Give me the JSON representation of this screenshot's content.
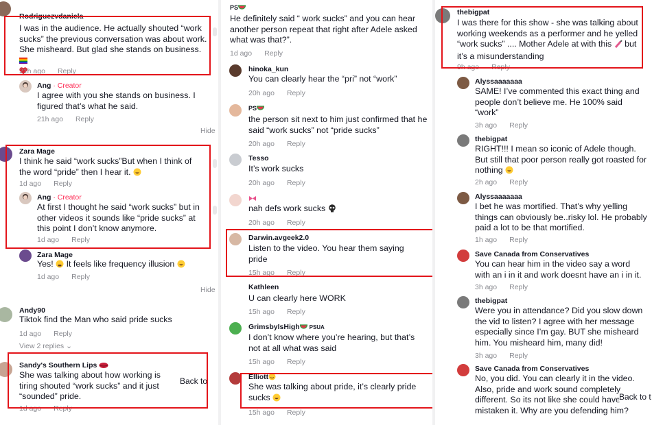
{
  "col1": {
    "c1": {
      "username": "Rodriguezvdaniela",
      "text": "I was in the audience. He actually shouted “work sucks” the previous conversation was about work. She misheard. But glad she stands on business.",
      "time": "21h ago",
      "reply": "Reply"
    },
    "c1r": {
      "username": "Ang",
      "badge": "· Creator",
      "text": "I agree with you she stands on business. I figured that’s what he said.",
      "time": "21h ago",
      "reply": "Reply"
    },
    "hide1": "Hide",
    "c2": {
      "username": "Zara Mage",
      "text": "I think he said “work sucks”But when I think of the word “pride” then I hear it.",
      "time": "1d ago",
      "reply": "Reply"
    },
    "c2r": {
      "username": "Ang",
      "badge": "· Creator",
      "text": "At first I thought he said “work sucks” but in other videos it sounds like “pride sucks” at this point I don’t know anymore.",
      "time": "1d ago",
      "reply": "Reply"
    },
    "c2r2": {
      "username": "Zara Mage",
      "text_a": "Yes!",
      "text_b": "It feels like frequency illusion",
      "time": "1d ago",
      "reply": "Reply"
    },
    "hide2": "Hide",
    "c3": {
      "username": "Andy90",
      "text": "Tiktok find the Man who said pride sucks",
      "time": "1d ago",
      "reply": "Reply",
      "view_replies": "View 2 replies"
    },
    "c4": {
      "username": "Sandy's Southern Lips",
      "text": "She was talking about how working is tiring shouted “work sucks” and it just “sounded” pride.",
      "time": "1d ago",
      "reply": "Reply"
    },
    "back_to": "Back to"
  },
  "col2": {
    "c1": {
      "username": "PS",
      "text": "He definitely said “ work sucks” and you can hear another person repeat that right after Adele asked what was that?”.",
      "time": "1d ago",
      "reply": "Reply"
    },
    "c2": {
      "username": "hinoka_kun",
      "text": "You can clearly hear the “pri” not “work”",
      "time": "20h ago",
      "reply": "Reply"
    },
    "c3": {
      "username": "PS",
      "text": "the person sit next to him just confirmed that he said “work sucks” not “pride sucks”",
      "time": "20h ago",
      "reply": "Reply"
    },
    "c4": {
      "username": "Tesso",
      "text": "It’s work sucks",
      "time": "20h ago",
      "reply": "Reply"
    },
    "c5": {
      "username": "",
      "text": "nah defs work sucks",
      "time": "20h ago",
      "reply": "Reply"
    },
    "c6": {
      "username": "Darwin.avgeek2.0",
      "text": "Listen to the video. You hear them saying pride",
      "time": "15h ago",
      "reply": "Reply"
    },
    "c7": {
      "username": "Kathleen",
      "text": "U can clearly here WORK",
      "time": "15h ago",
      "reply": "Reply"
    },
    "c8": {
      "username": "GrimsbyIsHigh",
      "suffix": "PSUA",
      "text": "I don’t know where you’re hearing, but that’s not at all what was said",
      "time": "15h ago",
      "reply": "Reply"
    },
    "c9": {
      "username": "Elliott",
      "text": "She was talking about pride, it’s clearly pride sucks",
      "time": "15h ago",
      "reply": "Reply"
    }
  },
  "col3": {
    "c1": {
      "username": "thebigpat",
      "text_a": "I was there for this show - she was talking about working weekends as a performer and he yelled “work sucks” .... Mother Adele at with this",
      "text_b": "but it’s a misunderstanding",
      "time": "9h ago",
      "reply": "Reply"
    },
    "c2": {
      "username": "Alyssaaaaaaa",
      "text": "SAME! I’ve commented this exact thing and people don’t believe me. He 100% said “work”",
      "time": "3h ago",
      "reply": "Reply"
    },
    "c3": {
      "username": "thebigpat",
      "text": "RIGHT!!! I mean so iconic of Adele though. But still that poor person really got roasted for nothing",
      "time": "2h ago",
      "reply": "Reply"
    },
    "c4": {
      "username": "Alyssaaaaaaa",
      "text": "I bet he was mortified. That’s why yelling things can obviously be..risky lol. He probably paid a lot to be that mortified.",
      "time": "1h ago",
      "reply": "Reply"
    },
    "c5": {
      "username": "Save Canada from Conservatives",
      "text": "You can hear him in the video say a word with an i in it and work doesnt have an i in it.",
      "time": "3h ago",
      "reply": "Reply"
    },
    "c6": {
      "username": "thebigpat",
      "text": "Were you in attendance? Did you slow down the vid to listen? I agree with her message especially since I’m gay. BUT she misheard him. You misheard him, many did!",
      "time": "3h ago",
      "reply": "Reply"
    },
    "c7": {
      "username": "Save Canada from Conservatives",
      "text": "No, you did. You can clearly it in the video. Also, pride and work sound completely different. So its not like she could have mistaken it. Why are you defending him?",
      "time": "3h ago",
      "reply": "Reply"
    },
    "back_to": "Back to t"
  },
  "colors": {
    "highlight": "#e3141a",
    "creator": "#fe2c55",
    "muted": "#8a8b91",
    "text": "#161823"
  }
}
